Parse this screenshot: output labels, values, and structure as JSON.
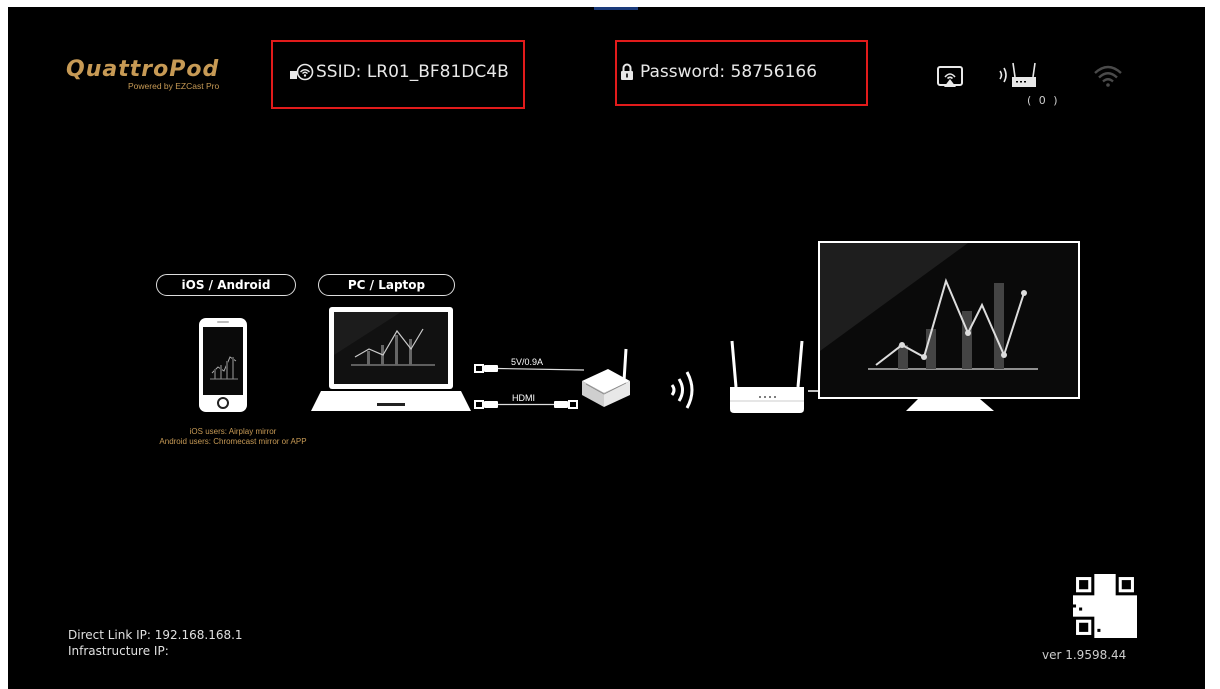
{
  "brand": {
    "name": "QuattroPod",
    "tagline": "Powered by EZCast Pro",
    "accent_color": "#c79a55",
    "highlight_color": "#e21b1b"
  },
  "header": {
    "ssid_label": "SSID: LR01_BF81DC4B",
    "ssid_icon": "wifi-dongle-icon",
    "password_label": "Password: 58756166",
    "password_icon": "lock-icon",
    "status_icons": [
      "airplay-icon",
      "router-icon",
      "wifi-signal-icon"
    ],
    "connected_count": "( 0 )"
  },
  "diagram": {
    "source_labels": [
      "iOS / Android",
      "PC / Laptop"
    ],
    "mobile_notes": [
      "iOS users: Airplay mirror",
      "Android users: Chromecast mirror or APP"
    ],
    "cable_labels": [
      "5V/0.9A",
      "HDMI"
    ]
  },
  "footer": {
    "direct_link_ip": "Direct Link IP: 192.168.168.1",
    "infrastructure_ip": "Infrastructure IP:",
    "version": "ver 1.9598.44"
  }
}
